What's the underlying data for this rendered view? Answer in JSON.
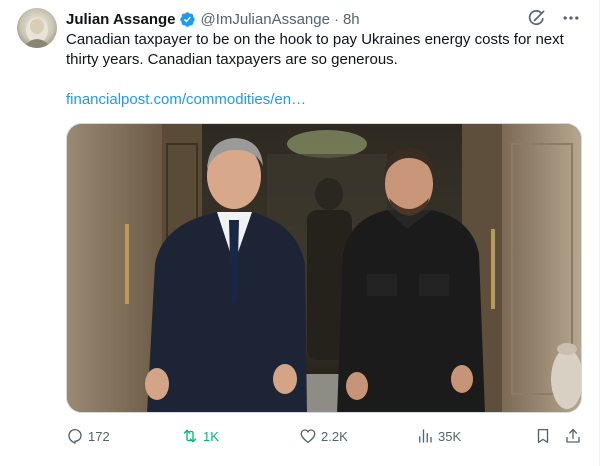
{
  "tweet": {
    "author_name": "Julian Assange",
    "handle": "@ImJulianAssange",
    "separator": "·",
    "time": "8h",
    "text": "Canadian taxpayer to be on the hook to pay Ukraines energy costs for next thirty years. Canadian taxpayers are so generous.",
    "link_text": "financialpost.com/commodities/en…",
    "icons": {
      "verified": "verified-badge-icon",
      "grok": "grok-icon",
      "more": "more-icon"
    }
  },
  "actions": {
    "replies": "172",
    "reposts": "1K",
    "likes": "2.2K",
    "views": "35K",
    "icons": [
      "reply-icon",
      "repost-icon",
      "like-icon",
      "views-icon",
      "bookmark-icon",
      "share-icon"
    ]
  },
  "colors": {
    "text": "#0f1419",
    "secondary": "#536471",
    "link": "#1d9bf0",
    "repost_active": "#00ba7c",
    "verified": "#1d9bf0"
  }
}
